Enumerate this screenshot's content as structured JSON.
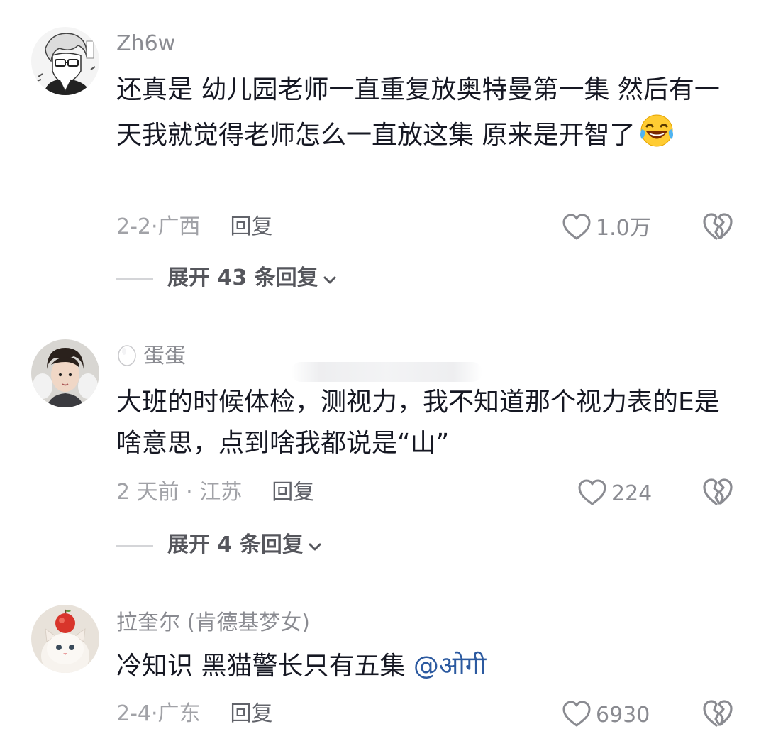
{
  "comments": [
    {
      "username": "Zh6w",
      "text": "还真是 幼儿园老师一直重复放奥特曼第一集 然后有一天我就觉得老师怎么一直放这集 原来是开智了",
      "emoji": "laughing-tears-emoji",
      "date": "2-2·",
      "location": "广西",
      "reply_label": "回复",
      "likes": "1.0万",
      "expand_label": "展开 43 条回复"
    },
    {
      "username": "蛋蛋",
      "text": "大班的时候体检，测视力，我不知道那个视力表的E是啥意思，点到啥我都说是“山”",
      "date": "2 天前 · ",
      "location": "江苏",
      "reply_label": "回复",
      "likes": "224",
      "expand_label": "展开 4 条回复"
    },
    {
      "username": "拉奎尔 (肯德基梦女)",
      "text": "冷知识 黑猫警长只有五集 ",
      "mention": "@ओगी",
      "date": "2-4·",
      "location": "广东",
      "reply_label": "回复",
      "likes": "6930"
    }
  ],
  "colors": {
    "text": "#161823",
    "secondary": "#8a8b91",
    "mention": "#2c5aa0"
  },
  "icons": [
    "heart-outline-icon",
    "broken-heart-icon",
    "chevron-down-icon",
    "egg-icon"
  ]
}
